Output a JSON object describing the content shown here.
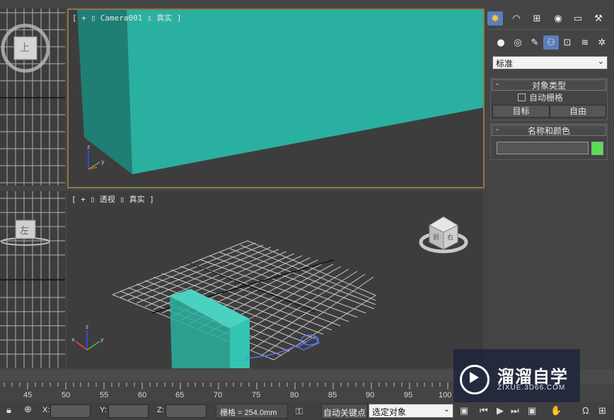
{
  "viewports": {
    "camera": {
      "label": "[ + ▯ Camera001 ▯ 真实 ]"
    },
    "perspective": {
      "label": "[ + ▯ 透视 ▯ 真实 ]"
    },
    "left_top_cube": {
      "label": "上"
    },
    "left_bottom_cube": {
      "label": "左"
    },
    "viewcube_faces": {
      "front": "前",
      "right": "右",
      "top": "上"
    }
  },
  "command_panel": {
    "tabs": [
      "create-tab",
      "modify-tab",
      "hierarchy-tab",
      "motion-tab",
      "display-tab",
      "utilities-tab"
    ],
    "subcategories": [
      "geometry",
      "shapes",
      "lights",
      "cameras",
      "helpers",
      "spacewarps",
      "systems"
    ],
    "category_dropdown": "标准",
    "object_type": {
      "title": "对象类型",
      "autogrid_label": "自动栅格",
      "buttons": [
        "目标",
        "自由"
      ]
    },
    "name_color": {
      "title": "名称和颜色",
      "name_value": "",
      "color": "#55e055"
    }
  },
  "timeline": {
    "ticks": [
      "45",
      "50",
      "55",
      "60",
      "65",
      "70",
      "75",
      "80",
      "85",
      "90",
      "95",
      "100"
    ]
  },
  "status": {
    "x_label": "X:",
    "y_label": "Y:",
    "z_label": "Z:",
    "grid_text": "栅格 = 254.0mm",
    "auto_key": "自动关键点",
    "selection_set": "选定对象"
  },
  "watermark": {
    "brand": "溜溜自学",
    "url": "ZIXUE.3D66.COM"
  },
  "colors": {
    "accent": "#5a7fb8",
    "teal": "#2ab0a0",
    "viewport_border": "#8a7a40",
    "grid_line": "#d0d0d0"
  }
}
